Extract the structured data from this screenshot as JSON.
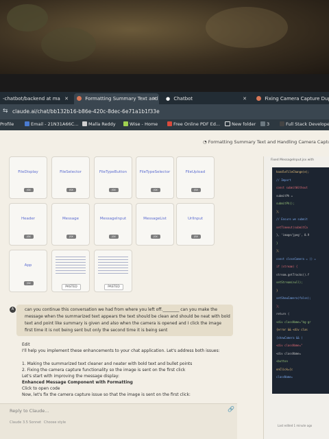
{
  "browser": {
    "tabs": [
      {
        "label": "-chatbot/backend at ma",
        "close": "✕",
        "active": false
      },
      {
        "label": "Formatting Summary Text and I",
        "close": "✕",
        "active": true
      },
      {
        "label": "Chatbot",
        "close": "✕",
        "active": false
      },
      {
        "label": "Fixing Camera Capture Duplic",
        "close": "",
        "active": false
      }
    ],
    "url": "claude.ai/chat/bb132b16-b86e-420c-8dec-6e71a1b1f33e",
    "bookmarks": [
      {
        "label": "Profile"
      },
      {
        "label": "Email - 21N31A66C..."
      },
      {
        "label": "Malla Reddy"
      },
      {
        "label": "Wise - Home"
      },
      {
        "label": "Free Online PDF Ed..."
      },
      {
        "label": "New folder"
      },
      {
        "label": "3"
      },
      {
        "label": "Full Stack Developer..."
      }
    ]
  },
  "conversation": {
    "title": "Formatting Summary Text and Handling Camera Captu"
  },
  "attachments": [
    {
      "name": "FileDisplay",
      "badge": "JSX"
    },
    {
      "name": "FileSelector",
      "badge": "JSX"
    },
    {
      "name": "FileTypeButton",
      "badge": "JSX"
    },
    {
      "name": "FileTypeSelector",
      "badge": "JSX"
    },
    {
      "name": "FileUpload",
      "badge": "JSX"
    },
    {
      "name": "Header",
      "badge": "JSX"
    },
    {
      "name": "Message",
      "badge": "JSX"
    },
    {
      "name": "MessageInput",
      "badge": "JSX"
    },
    {
      "name": "MessageList",
      "badge": "JSX"
    },
    {
      "name": "UrlInput",
      "badge": "JSX"
    },
    {
      "name": "App",
      "badge": "JSX"
    },
    {
      "name": "",
      "badge": "PASTED"
    },
    {
      "name": "",
      "badge": "PASTED"
    }
  ],
  "user_message": {
    "avatar": "A",
    "text": "can you continue this conversation we had from where you left off.________ can you make the message when the summarized text appears the text should be clean and should be neat with bold text and point like summary is given and also when the camera is opened and I click the image first time it is not being sent but only the second time it is being sent"
  },
  "response": {
    "edit": "Edit",
    "intro": "I'll help you implement these enhancements to your chat application. Let's address both issues:",
    "points": [
      "1. Making the summarized text cleaner and neater with bold text and bullet points",
      "2. Fixing the camera capture functionality so the image is sent on the first click"
    ],
    "start": "Let's start with improving the message display:",
    "component_title": "Enhanced Message Component with Formatting",
    "open_code": "Click to open code",
    "next": "Now, let's fix the camera capture issue so that the image is sent on the first click:"
  },
  "composer": {
    "placeholder": "Reply to Claude...",
    "model": "Claude 3.5 Sonnet",
    "style": "Choose style"
  },
  "artifact": {
    "header": "Fixed MessageInput.jsx with",
    "code_lines": [
      "handleFileChange(e);",
      "// Import",
      "const submitWithout",
      "  submitPh =",
      "  submitPh();",
      "};",
      "// Ensure we submit",
      "setTimeout(submitCa",
      "}, 'image/jpeg', 0.9",
      "}",
      "};",
      "const closeCamera = () =",
      "  if (stream) {",
      "    stream.getTracks().f",
      "    setStream(null);",
      "  }",
      "  setShowCamera(false);",
      "};",
      "return (",
      "  <div className=\"bg-gr",
      "    {error && <div clas",
      "    {showCamera && (",
      "      <div className=\"",
      "        <div className=",
      "          <button",
      "            onClick={c",
      "            className="
    ],
    "footer": "Last edited 1 minute ago"
  }
}
